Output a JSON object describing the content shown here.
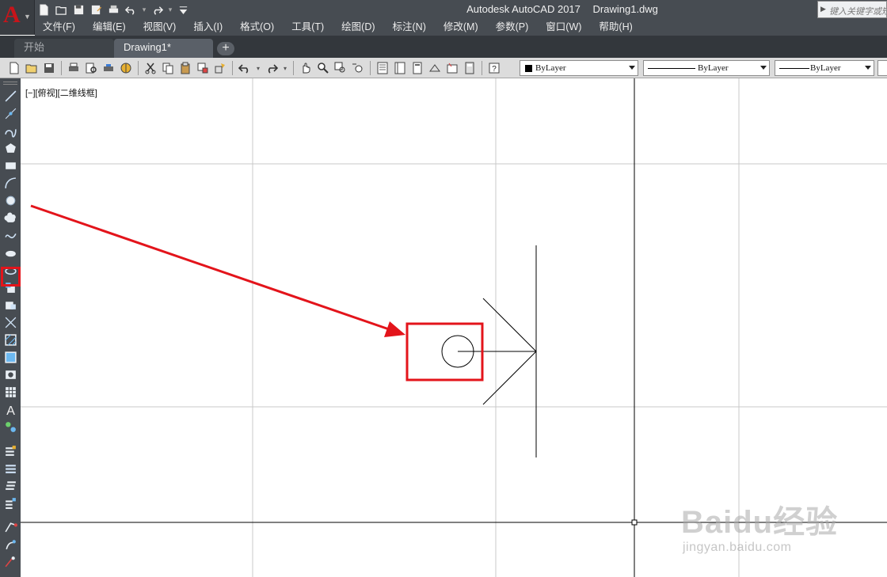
{
  "app": {
    "title": "Autodesk AutoCAD 2017",
    "document": "Drawing1.dwg",
    "logo_letter": "A",
    "search_placeholder": "键入关键字或短语"
  },
  "menubar": {
    "items": [
      "文件(F)",
      "编辑(E)",
      "视图(V)",
      "插入(I)",
      "格式(O)",
      "工具(T)",
      "绘图(D)",
      "标注(N)",
      "修改(M)",
      "参数(P)",
      "窗口(W)",
      "帮助(H)"
    ]
  },
  "tabs": [
    {
      "label": "开始",
      "active": false
    },
    {
      "label": "Drawing1*",
      "active": true
    }
  ],
  "tab_add_label": "+",
  "properties": {
    "color": "ByLayer",
    "linetype": "ByLayer",
    "lineweight": "ByLayer"
  },
  "viewport": {
    "label": "[−][俯视][二维线框]"
  },
  "annotation": {
    "highlight_color": "#e3141b"
  },
  "watermark": {
    "logo": "Baidu经验",
    "url": "jingyan.baidu.com"
  },
  "colors": {
    "titlebar": "#474c52",
    "tabbar": "#33373c",
    "toolbar": "#dcdcdc",
    "canvas": "#ffffff",
    "grid": "#c8c8c8",
    "highlight": "#e3141b"
  }
}
